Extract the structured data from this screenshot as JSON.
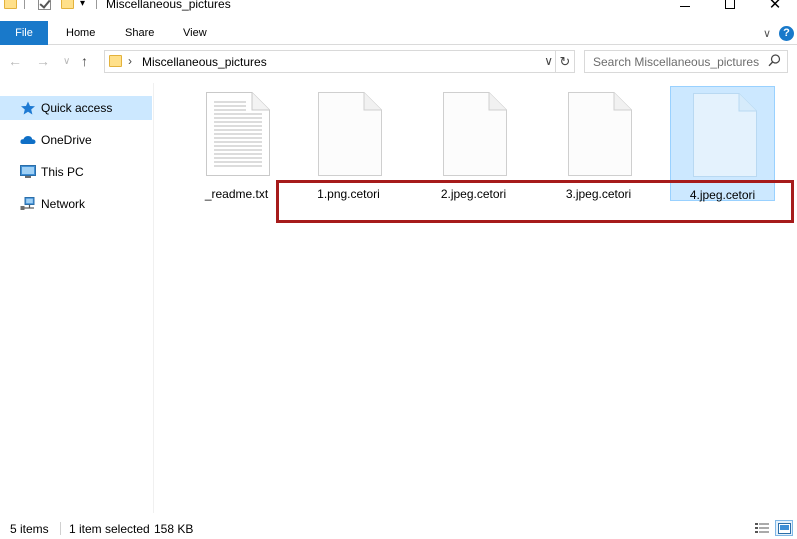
{
  "window": {
    "title": "Miscellaneous_pictures"
  },
  "ribbon": {
    "tabs": [
      "File",
      "Home",
      "Share",
      "View"
    ]
  },
  "address": {
    "path": "Miscellaneous_pictures"
  },
  "search": {
    "placeholder": "Search Miscellaneous_pictures"
  },
  "nav_pane": {
    "items": [
      {
        "label": "Quick access",
        "icon": "star-icon",
        "selected": true
      },
      {
        "label": "OneDrive",
        "icon": "cloud-icon",
        "selected": false
      },
      {
        "label": "This PC",
        "icon": "computer-icon",
        "selected": false
      },
      {
        "label": "Network",
        "icon": "network-icon",
        "selected": false
      }
    ]
  },
  "files": [
    {
      "name": "_readme.txt",
      "type": "text",
      "selected": false
    },
    {
      "name": "1.png.cetori",
      "type": "blank",
      "selected": false
    },
    {
      "name": "2.jpeg.cetori",
      "type": "blank",
      "selected": false
    },
    {
      "name": "3.jpeg.cetori",
      "type": "blank",
      "selected": false
    },
    {
      "name": "4.jpeg.cetori",
      "type": "blank",
      "selected": true
    }
  ],
  "status": {
    "items_count": "5 items",
    "selection": "1 item selected",
    "size": "158 KB"
  },
  "colors": {
    "accent": "#1979ca",
    "selection_bg": "#cce8ff",
    "highlight_border": "#a61b1b"
  }
}
